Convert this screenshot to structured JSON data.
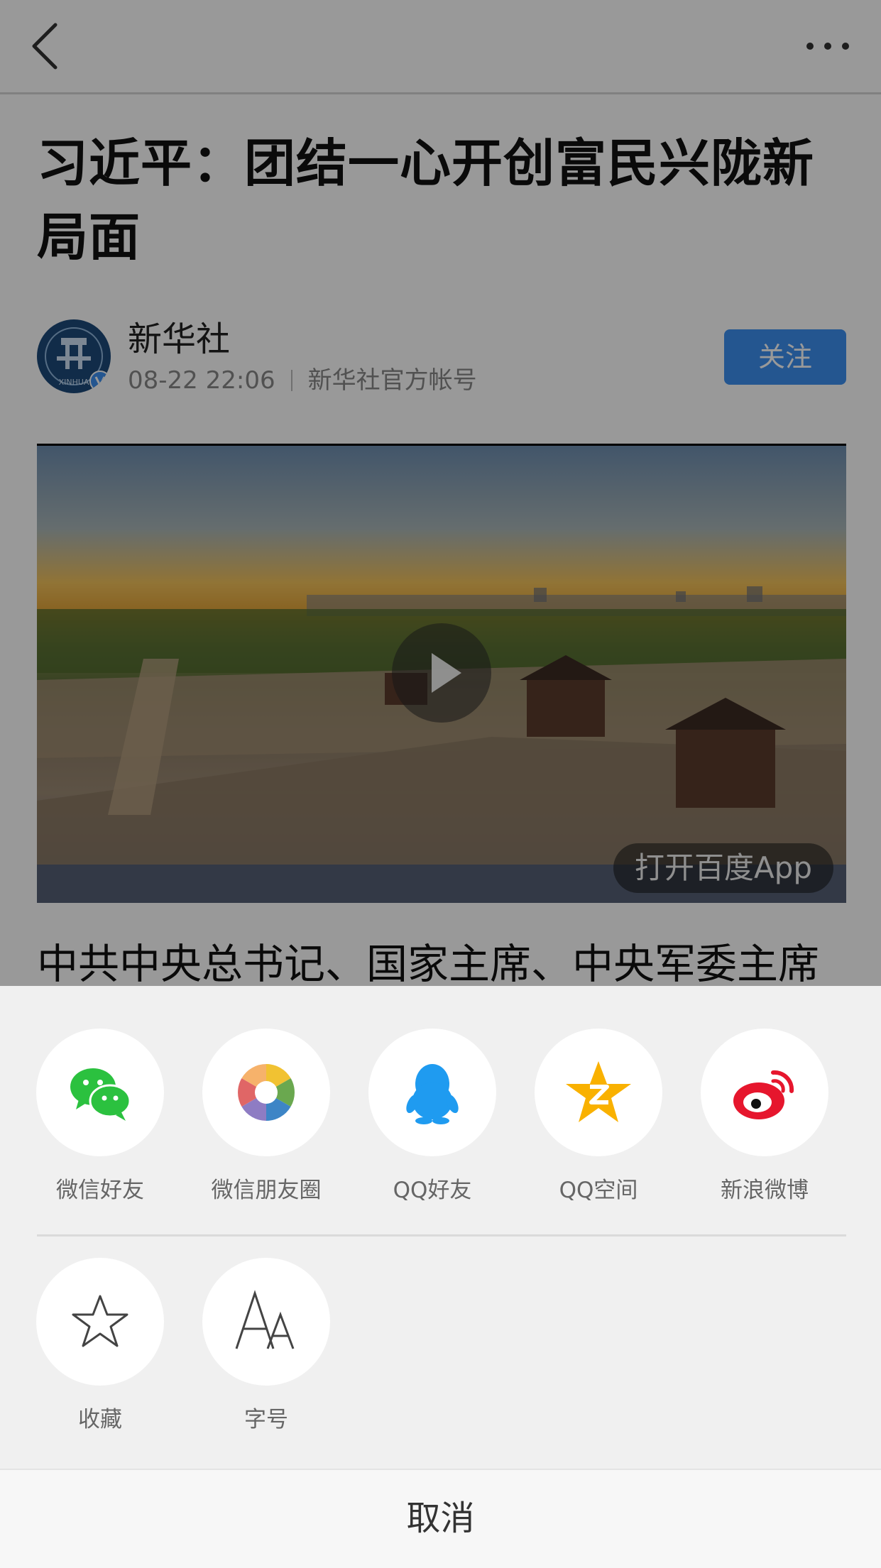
{
  "article": {
    "title": "习近平：团结一心开创富民兴陇新局面",
    "author": {
      "name": "新华社",
      "time": "08-22 22:06",
      "account_desc": "新华社官方帐号",
      "avatar_text": "XINHUA",
      "follow_label": "关注"
    },
    "video": {
      "open_app_label": "打开百度App"
    },
    "body_first_line": "中共中央总书记、国家主席、中央军委主席"
  },
  "share_sheet": {
    "share_targets": [
      {
        "label": "微信好友",
        "icon": "wechat-icon"
      },
      {
        "label": "微信朋友圈",
        "icon": "moments-icon"
      },
      {
        "label": "QQ好友",
        "icon": "qq-icon"
      },
      {
        "label": "QQ空间",
        "icon": "qzone-icon"
      },
      {
        "label": "新浪微博",
        "icon": "weibo-icon"
      }
    ],
    "actions": [
      {
        "label": "收藏",
        "icon": "star-icon"
      },
      {
        "label": "字号",
        "icon": "font-size-icon"
      }
    ],
    "cancel_label": "取消"
  },
  "colors": {
    "follow": "#3d8ff0",
    "wechat": "#2bc13f",
    "qq": "#1f9bf0",
    "qzone": "#f9b100",
    "weibo": "#e6162d",
    "sheet_bg": "#f0f0f0"
  }
}
